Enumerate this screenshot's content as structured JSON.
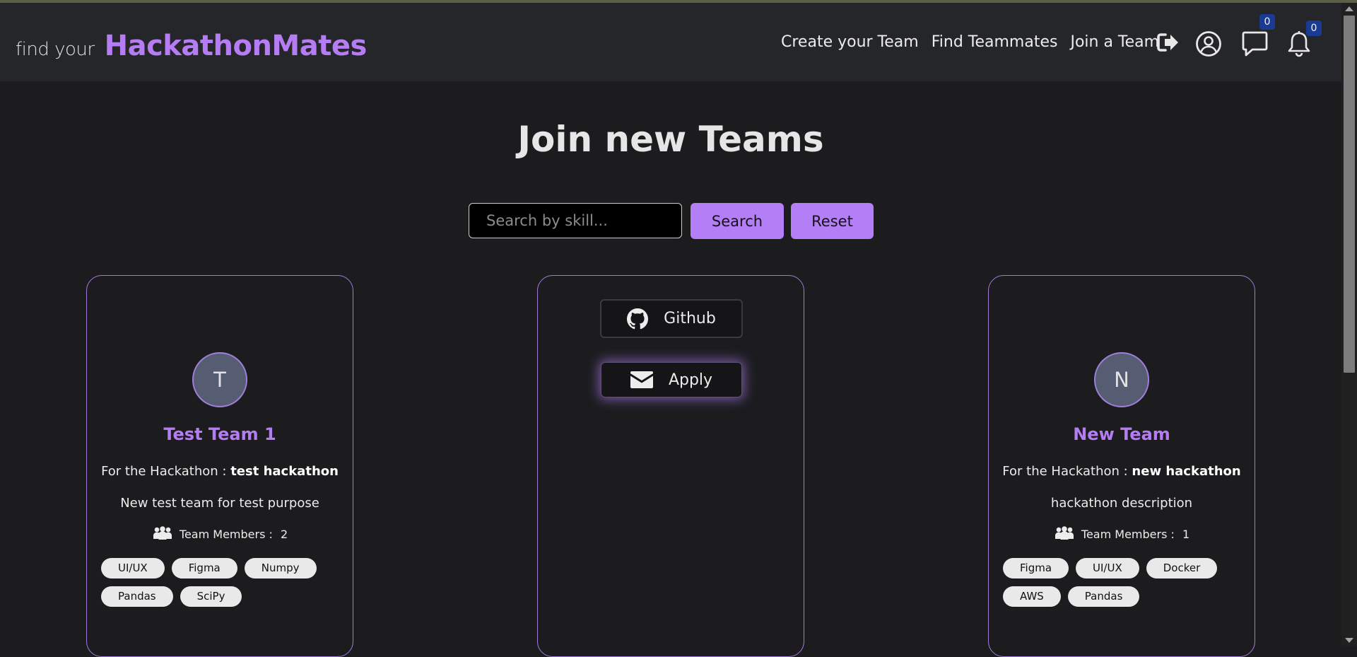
{
  "header": {
    "brand_prefix": "find your",
    "brand_name": "HackathonMates",
    "nav": [
      "Create your Team",
      "Find Teammates",
      "Join a Team"
    ],
    "icons": [
      "logout-icon",
      "user-circle-icon",
      "chat-icon",
      "bell-icon"
    ],
    "messages_count": "0",
    "notifications_count": "0"
  },
  "main": {
    "title": "Join new Teams",
    "search_placeholder": "Search by skill...",
    "search_label": "Search",
    "reset_label": "Reset"
  },
  "cards": [
    {
      "initial": "T",
      "name": "Test Team 1",
      "hackathon_prefix": "For the Hackathon :",
      "hackathon": "test hackathon",
      "description": "New test team for test purpose",
      "members_label": "Team Members :",
      "members_count": "2",
      "skills": [
        "UI/UX",
        "Figma",
        "Numpy",
        "Pandas",
        "SciPy"
      ]
    },
    {
      "github_label": "Github",
      "apply_label": "Apply"
    },
    {
      "initial": "N",
      "name": "New Team",
      "hackathon_prefix": "For the Hackathon :",
      "hackathon": "new hackathon",
      "description": "hackathon description",
      "members_label": "Team Members :",
      "members_count": "1",
      "skills": [
        "Figma",
        "UI/UX",
        "Docker",
        "AWS",
        "Pandas"
      ]
    }
  ],
  "colors": {
    "background": "#1c1c1f",
    "header": "#25262a",
    "accent": "#b57cf3",
    "badge": "#1b3b92"
  }
}
